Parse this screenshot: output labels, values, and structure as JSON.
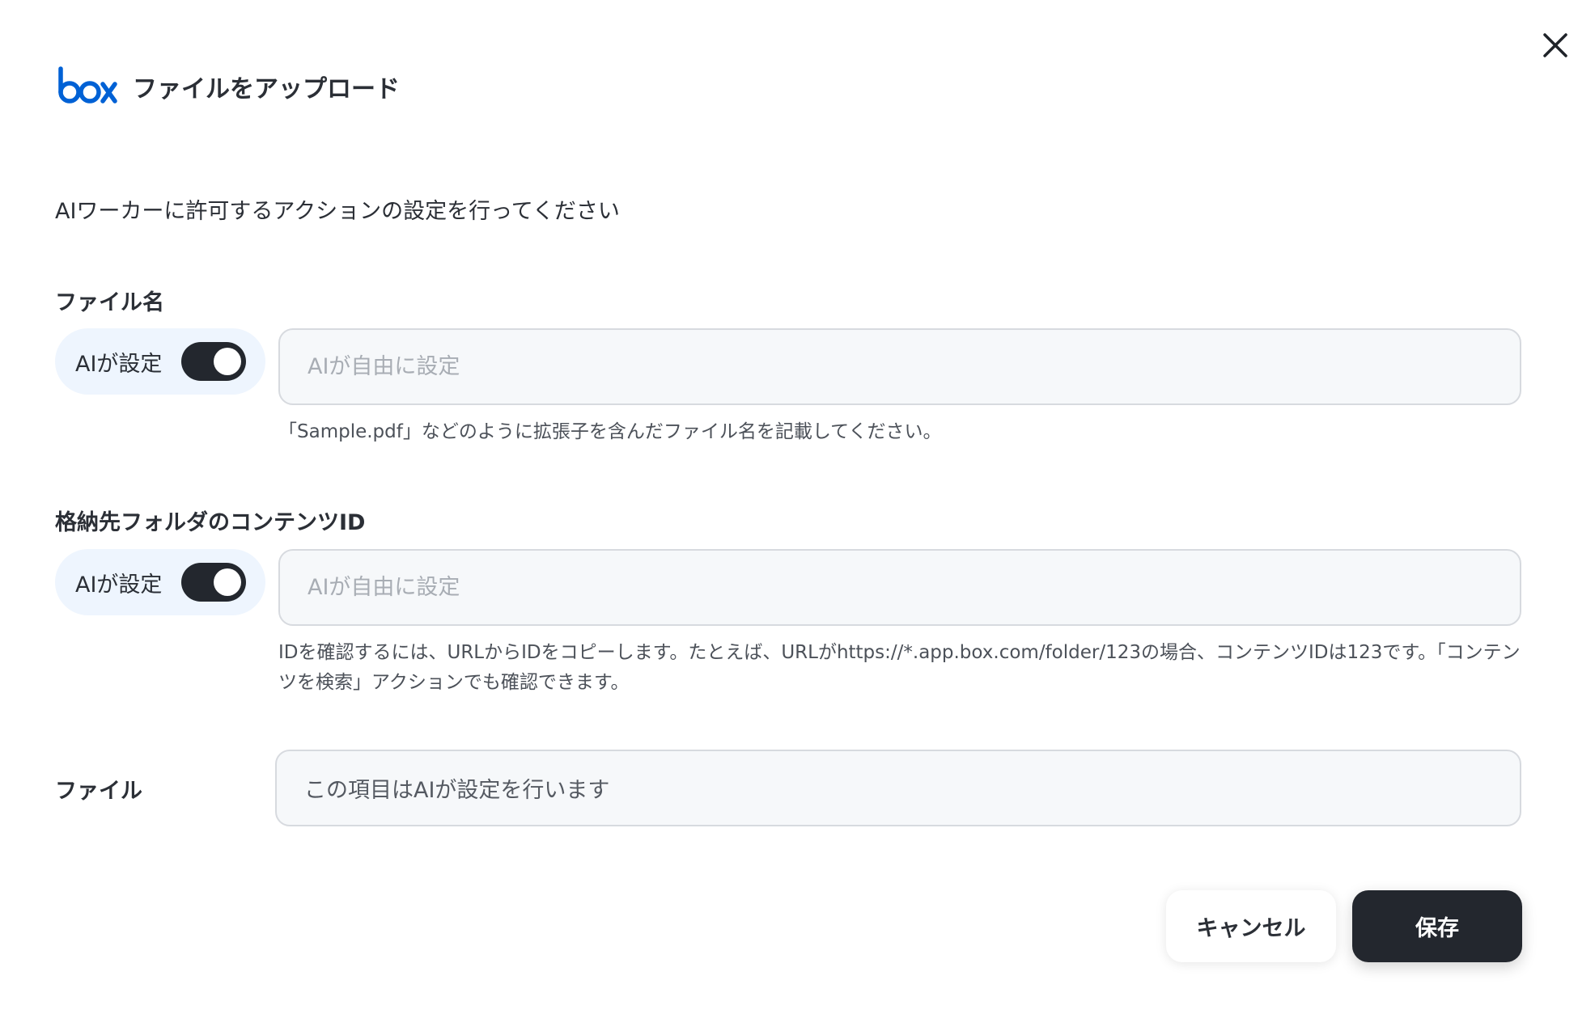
{
  "header": {
    "logo_text": "box",
    "title": "ファイルをアップロード"
  },
  "intro": "AIワーカーに許可するアクションの設定を行ってください",
  "fields": {
    "file_name": {
      "label": "ファイル名",
      "ai_toggle_label": "AIが設定",
      "ai_toggle_on": true,
      "placeholder": "AIが自由に設定",
      "help": "「Sample.pdf」などのように拡張子を含んだファイル名を記載してください。"
    },
    "folder_id": {
      "label": "格納先フォルダのコンテンツID",
      "ai_toggle_label": "AIが設定",
      "ai_toggle_on": true,
      "placeholder": "AIが自由に設定",
      "help": "IDを確認するには、URLからIDをコピーします。たとえば、URLがhttps://*.app.box.com/folder/123の場合、コンテンツIDは123です。「コンテンツを検索」アクションでも確認できます。"
    },
    "file": {
      "label": "ファイル",
      "value": "この項目はAIが設定を行います"
    }
  },
  "buttons": {
    "cancel": "キャンセル",
    "save": "保存"
  },
  "icons": {
    "close": "close-icon",
    "logo": "box-logo-icon"
  },
  "colors": {
    "brand": "#0061d5",
    "toggle_on": "#23272e",
    "pill_bg": "#eef5fe",
    "input_bg": "#f6f8fa",
    "primary_button": "#23272e"
  }
}
